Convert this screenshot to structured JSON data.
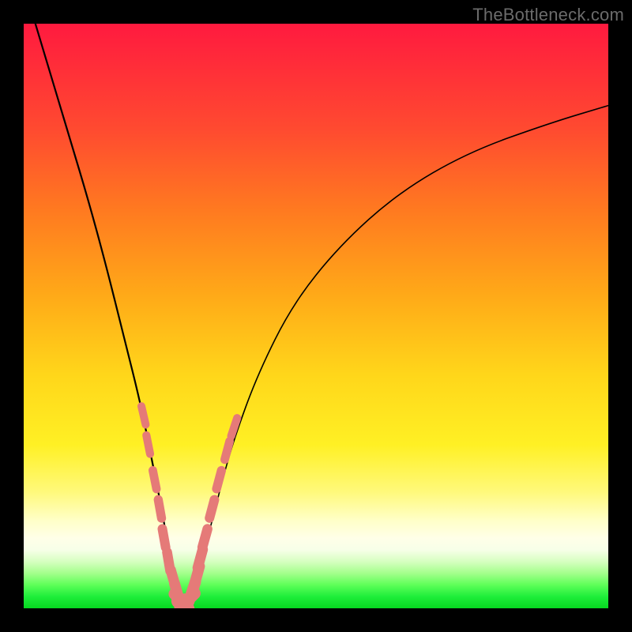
{
  "watermark": "TheBottleneck.com",
  "colors": {
    "bead": "#e57a78",
    "curve": "#000000"
  },
  "chart_data": {
    "type": "line",
    "title": "",
    "xlabel": "",
    "ylabel": "",
    "xlim": [
      0,
      100
    ],
    "ylim": [
      0,
      100
    ],
    "note": "Axes unlabeled; x is relative position (0=left,100=right), y is bottleneck metric (0=bottom/green optimal, 100=top/red worst). Curve minimum near x≈27.",
    "series": [
      {
        "name": "bottleneck-curve",
        "x": [
          2,
          5,
          8,
          11,
          14,
          17,
          20,
          22,
          24,
          25,
          26,
          27,
          28,
          29,
          30,
          32,
          34,
          36,
          40,
          46,
          54,
          64,
          76,
          90,
          100
        ],
        "y": [
          100,
          90,
          80,
          70,
          59,
          47,
          35,
          25,
          15,
          8,
          3,
          1,
          1,
          3,
          7,
          14,
          22,
          29,
          40,
          52,
          62,
          71,
          78,
          83,
          86
        ]
      }
    ],
    "markers": {
      "name": "beads",
      "description": "Salmon-colored rounded markers clustered near the curve minimum",
      "x": [
        20.5,
        21.3,
        22.4,
        23.3,
        24.0,
        24.8,
        25.6,
        26.3,
        27.0,
        28.0,
        28.8,
        29.6,
        30.2,
        31.0,
        32.2,
        33.4,
        34.8,
        36.0
      ],
      "y": [
        33,
        28,
        22,
        17,
        12,
        8,
        5,
        2.5,
        1.2,
        1.3,
        2.8,
        5.5,
        8.5,
        12,
        17,
        22,
        27,
        31
      ]
    }
  }
}
